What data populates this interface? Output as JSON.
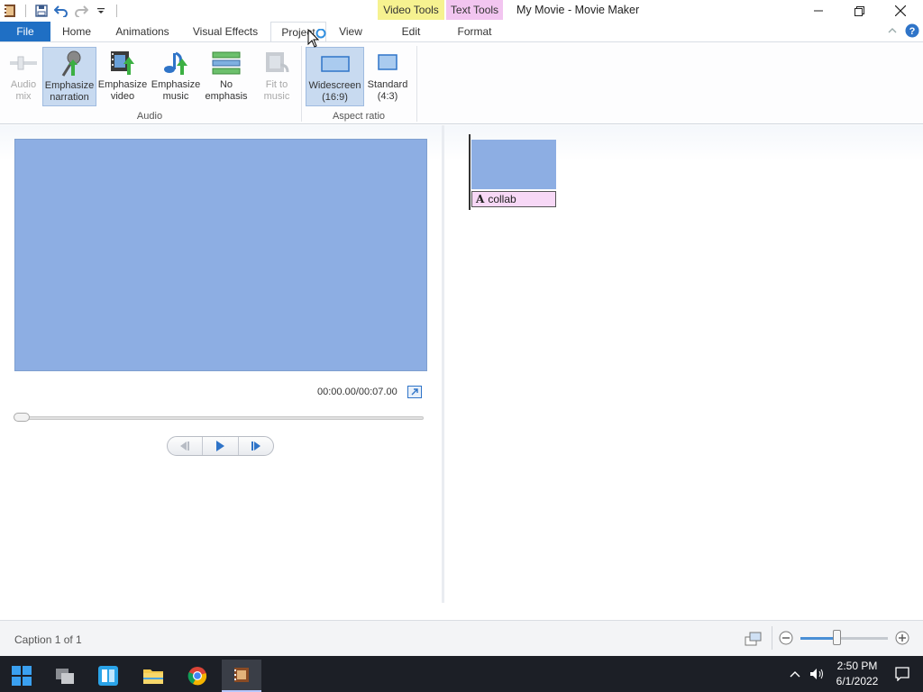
{
  "window": {
    "title": "My Movie - Movie Maker",
    "context_tabs": {
      "video_tools": "Video Tools",
      "text_tools": "Text Tools"
    }
  },
  "tabs": {
    "file": "File",
    "home": "Home",
    "animations": "Animations",
    "visual_effects": "Visual Effects",
    "project": "Project",
    "view": "View",
    "edit": "Edit",
    "format": "Format"
  },
  "ribbon": {
    "audio_mix": [
      "Audio",
      "mix"
    ],
    "emphasize_narration": [
      "Emphasize",
      "narration"
    ],
    "emphasize_video": [
      "Emphasize",
      "video"
    ],
    "emphasize_music": [
      "Emphasize",
      "music"
    ],
    "no_emphasis": [
      "No",
      "emphasis"
    ],
    "fit_to_music": [
      "Fit to",
      "music"
    ],
    "widescreen": [
      "Widescreen",
      "(16:9)"
    ],
    "standard": [
      "Standard",
      "(4:3)"
    ],
    "group_audio": "Audio",
    "group_aspect": "Aspect ratio"
  },
  "preview": {
    "timecode": "00:00.00/00:07.00",
    "color": "#8daee3"
  },
  "storyboard": {
    "caption_text": "collab",
    "caption_icon": "A"
  },
  "status": {
    "caption_info": "Caption 1 of 1",
    "zoom_level": 0.4
  },
  "taskbar": {
    "time": "2:50 PM",
    "date": "6/1/2022"
  },
  "colors": {
    "file_tab": "#1f6fc4",
    "video_tools": "#f6f290",
    "text_tools": "#f2c5f0",
    "caption_bg": "#f7d8f6"
  }
}
